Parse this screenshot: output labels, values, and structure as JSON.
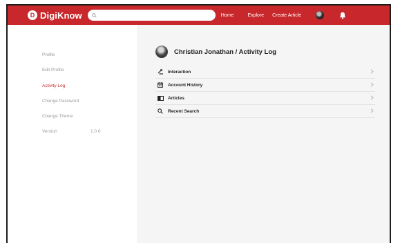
{
  "app": {
    "name": "DigiKnow",
    "logo_letter": "D",
    "accent_color": "#c8282b"
  },
  "header": {
    "search_placeholder": "",
    "nav": {
      "home": "Home",
      "explore": "Explore",
      "create_article": "Create Article"
    },
    "icons": [
      "search-icon",
      "user-avatar",
      "bell-icon"
    ]
  },
  "sidebar": {
    "items": [
      {
        "label": "Profile",
        "active": false
      },
      {
        "label": "Edit Profile",
        "active": false
      },
      {
        "label": "Activity Log",
        "active": true
      },
      {
        "label": "Change Password",
        "active": false
      },
      {
        "label": "Change Theme",
        "active": false
      },
      {
        "label": "Version",
        "active": false
      }
    ],
    "version_value": "1.0.0"
  },
  "main": {
    "title": "Christian Jonathan / Activity Log",
    "menu": [
      {
        "label": "Interaction",
        "icon": "interaction-icon"
      },
      {
        "label": "Account History",
        "icon": "calendar-icon"
      },
      {
        "label": "Articles",
        "icon": "articles-icon"
      },
      {
        "label": "Recent Search",
        "icon": "search-icon"
      }
    ]
  }
}
